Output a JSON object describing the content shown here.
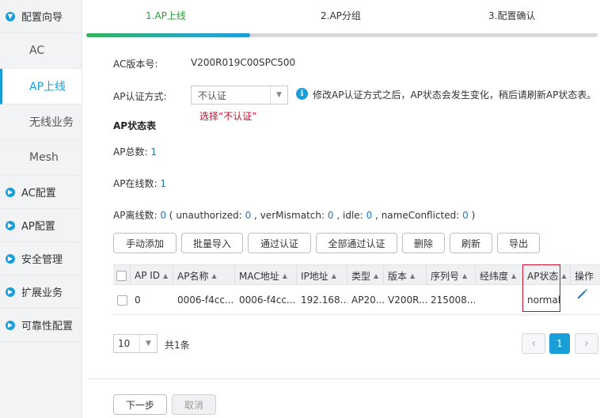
{
  "sidebar": {
    "groups": [
      {
        "label": "配置向导",
        "expanded": true
      },
      {
        "label": "AC配置"
      },
      {
        "label": "AP配置"
      },
      {
        "label": "安全管理"
      },
      {
        "label": "扩展业务"
      },
      {
        "label": "可靠性配置"
      }
    ],
    "wizard_items": [
      "AC",
      "AP上线",
      "无线业务",
      "Mesh"
    ],
    "active_item": "AP上线"
  },
  "steps": [
    {
      "label": "1.AP上线",
      "active": true
    },
    {
      "label": "2.AP分组",
      "active": false
    },
    {
      "label": "3.配置确认",
      "active": false
    }
  ],
  "progress": {
    "fraction": 0.32
  },
  "form": {
    "ac_version_label": "AC版本号:",
    "ac_version_value": "V200R019C00SPC500",
    "auth_label": "AP认证方式:",
    "auth_value": "不认证",
    "auth_hint": "修改AP认证方式之后，AP状态会发生变化，稍后请刷新AP状态表。",
    "annotation": "选择“不认证”"
  },
  "status": {
    "title": "AP状态表",
    "total_label": "AP总数:",
    "total_value": "1",
    "online_label": "AP在线数:",
    "online_value": "1",
    "offline_label": "AP离线数:",
    "offline_value": "0",
    "paren_open": "(",
    "paren_close": ")",
    "comma": ",",
    "unauthorized_label": "unauthorized:",
    "unauthorized_value": "0",
    "vermismatch_label": "verMismatch:",
    "vermismatch_value": "0",
    "idle_label": "idle:",
    "idle_value": "0",
    "nameconflicted_label": "nameConflicted:",
    "nameconflicted_value": "0"
  },
  "toolbar": {
    "manual_add": "手动添加",
    "batch_import": "批量导入",
    "pass_auth": "通过认证",
    "pass_all": "全部通过认证",
    "delete": "删除",
    "refresh": "刷新",
    "export": "导出"
  },
  "table": {
    "headers": [
      "AP ID",
      "AP名称",
      "MAC地址",
      "IP地址",
      "类型",
      "版本",
      "序列号",
      "经纬度",
      "AP状态",
      "操作"
    ],
    "rows": [
      [
        "0",
        "0006-f4cc...",
        "0006-f4cc...",
        "192.168....",
        "AP20...",
        "V200R...",
        "215008...",
        "",
        "normal",
        ""
      ]
    ]
  },
  "pager": {
    "page_size": "10",
    "total": "共1条",
    "current_page": "1",
    "prev": "‹",
    "next": "›",
    "caret": "▼"
  },
  "footer": {
    "next": "下一步",
    "cancel": "取消"
  },
  "icons": {
    "group": "circle-chevron-icon",
    "info": "info-icon",
    "edit": "pencil-icon",
    "sort": "sort-up-icon"
  },
  "colors": {
    "accent": "#1a9ed8",
    "step_active": "#2a9d3d",
    "annotation": "#c8102e"
  }
}
